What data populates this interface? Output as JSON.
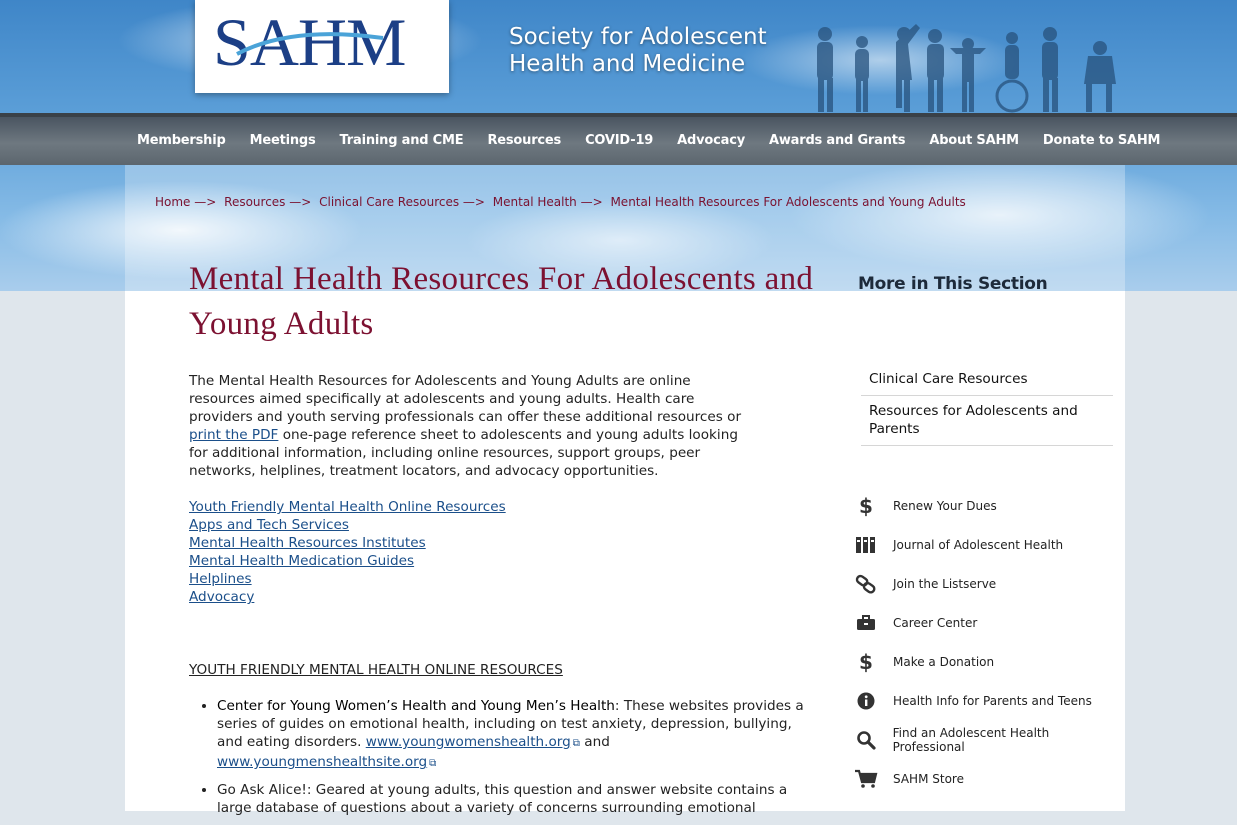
{
  "site": {
    "logo_text": "SAHM",
    "name_line1": "Society for Adolescent",
    "name_line2": "Health and Medicine"
  },
  "nav": {
    "items": [
      "Membership",
      "Meetings",
      "Training and CME",
      "Resources",
      "COVID-19",
      "Advocacy",
      "Awards and Grants",
      "About SAHM",
      "Donate to SAHM"
    ]
  },
  "breadcrumb": {
    "items": [
      "Home —>",
      "Resources —>",
      "Clinical Care Resources —>",
      "Mental Health —>",
      "Mental Health Resources For Adolescents and Young Adults"
    ]
  },
  "page": {
    "title": "Mental Health Resources For Adolescents and Young Adults",
    "intro_before_link": "The Mental Health Resources for Adolescents and Young Adults are online resources aimed specifically at adolescents and young adults.  Health care providers and youth serving professionals can offer these additional resources or ",
    "intro_link": "print the PDF",
    "intro_after_link": " one-page reference sheet to adolescents and young adults looking for additional information, including online resources, support groups, peer networks, helplines, treatment locators, and advocacy opportunities.",
    "jump_links": [
      "Youth Friendly Mental Health Online Resources",
      "Apps and Tech Services",
      "Mental Health Resources Institutes",
      "Mental Health Medication Guides",
      "Helplines",
      "Advocacy"
    ],
    "section_heading": "YOUTH FRIENDLY MENTAL HEALTH ONLINE RESOURCES",
    "resource1_name": "Center for Young Women’s Health and Young Men’s Health",
    "resource1_text": ": These websites provides a series of guides on emotional health, including on test anxiety, depression, bullying, and eating disorders. ",
    "resource1_link1": "www.youngwomenshealth.org",
    "resource1_and": " and ",
    "resource1_link2": "www.youngmenshealthsite.org",
    "resource2_text": "Go Ask Alice!: Geared at young adults, this question and answer website contains a large database of questions about a variety of concerns surrounding emotional"
  },
  "sidebar": {
    "title": "More in This Section",
    "section_links": [
      "Clinical Care Resources",
      "Resources for Adolescents and Parents"
    ],
    "quick_links": [
      {
        "label": "Renew Your Dues",
        "icon": "dollar-icon"
      },
      {
        "label": "Journal of Adolescent Health",
        "icon": "books-icon"
      },
      {
        "label": "Join the Listserve",
        "icon": "link-icon"
      },
      {
        "label": "Career Center",
        "icon": "briefcase-icon"
      },
      {
        "label": "Make a Donation",
        "icon": "dollar-icon"
      },
      {
        "label": "Health Info for Parents and Teens",
        "icon": "info-icon"
      },
      {
        "label": "Find an Adolescent Health Professional",
        "icon": "magnifier-icon"
      },
      {
        "label": "SAHM Store",
        "icon": "cart-icon"
      }
    ]
  },
  "colors": {
    "title": "#7c1131",
    "link": "#1b4f8a",
    "nav_bg": "#5c666e",
    "logo": "#1c3f86"
  }
}
